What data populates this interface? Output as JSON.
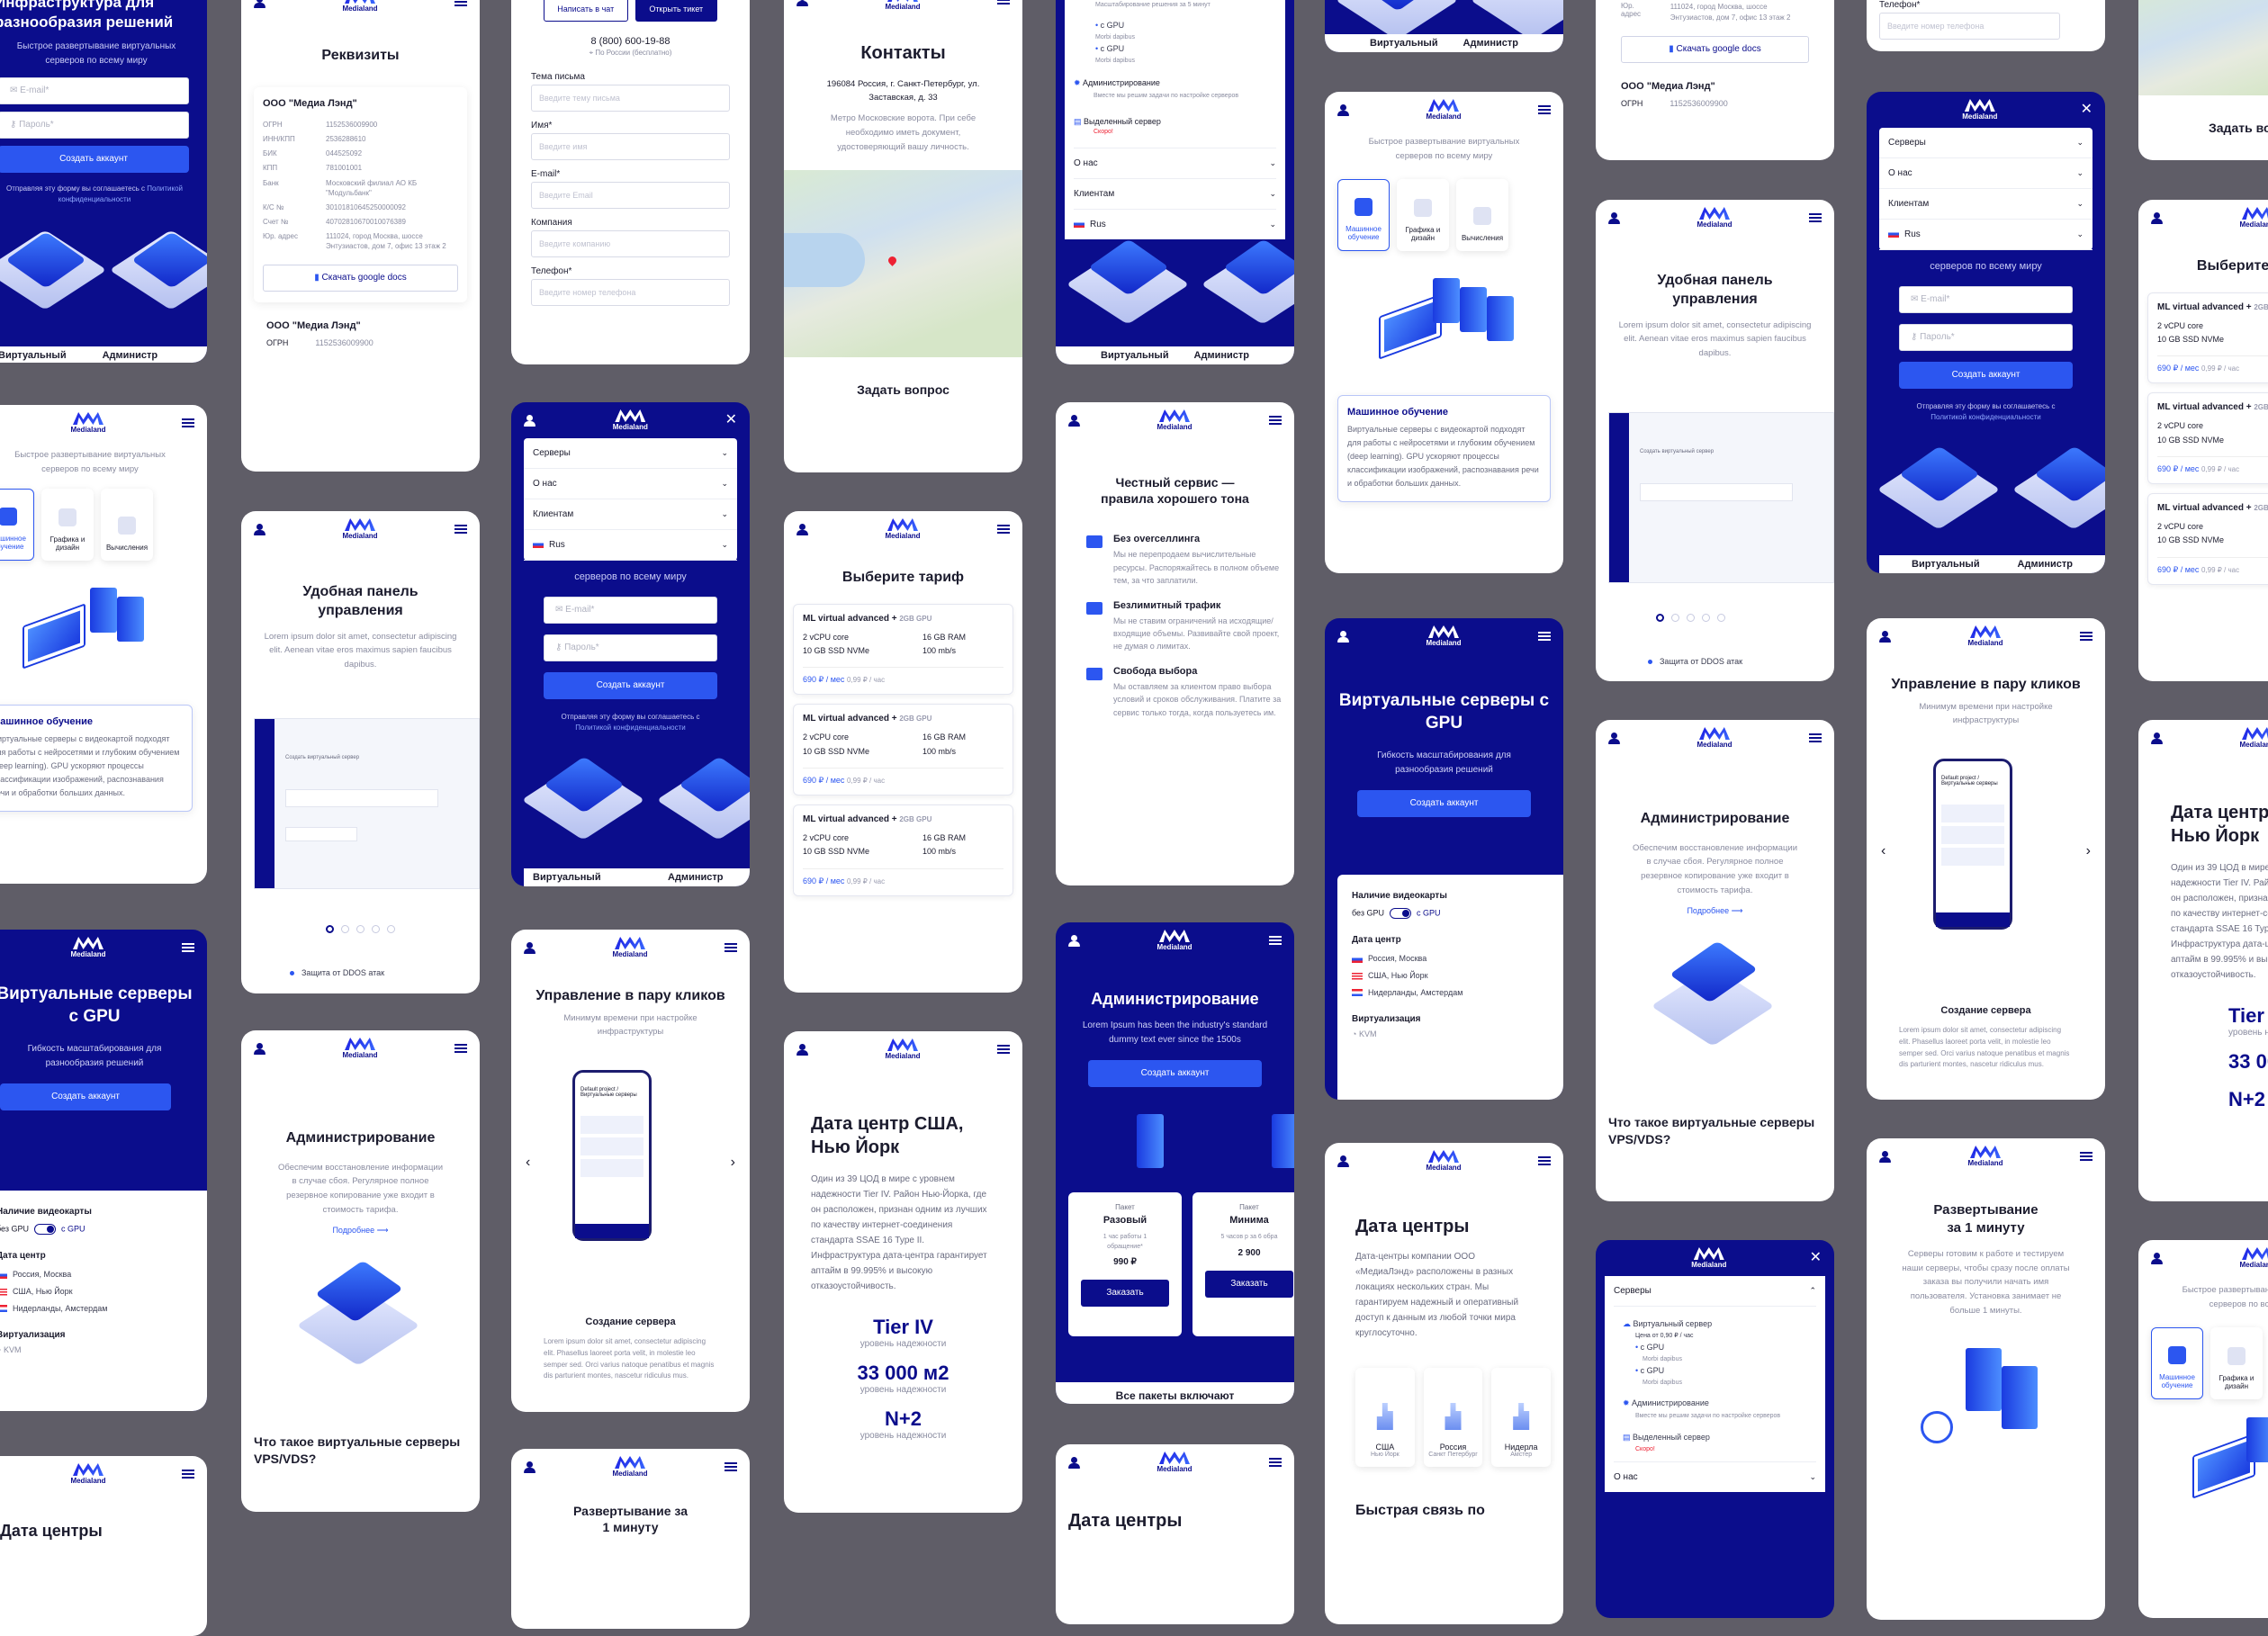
{
  "brand": {
    "logo_text": "Medialand"
  },
  "hero": {
    "title_part1": "Инфраструктура для",
    "title_part2": "разнообразия решений",
    "subtitle": "Быстрое развертывание виртуальных серверов по всему миру",
    "subtitle_tail": "серверов по всему миру",
    "email_placeholder": "E-mail*",
    "password_placeholder": "Пароль*",
    "create_account": "Создать аккаунт",
    "consent_part1": "Отправляя эту форму вы соглашаетесь с",
    "consent_link": "Политикой конфиденциальности",
    "tiles": [
      "Виртуальный",
      "Администр"
    ]
  },
  "requisites": {
    "title": "Реквизиты",
    "company": "ООО \"Медиа Лэнд\"",
    "rows": [
      {
        "k": "ОГРН",
        "v": "1152536009900"
      },
      {
        "k": "ИНН/КПП",
        "v": "2536288610"
      },
      {
        "k": "БИК",
        "v": "044525092"
      },
      {
        "k": "КПП",
        "v": "781001001"
      },
      {
        "k": "Банк",
        "v": "Московский филиал АО КБ \"Модульбанк\""
      },
      {
        "k": "К/С №",
        "v": "30101810645250000092"
      },
      {
        "k": "Счет №",
        "v": "40702810670010076389"
      },
      {
        "k": "Юр. адрес",
        "v": "111024, город Москва, шоссе Энтузиастов, дом 7, офис 13 этаж 2"
      }
    ],
    "download": "Скачать google docs"
  },
  "support": {
    "chat": "Написать в чат",
    "ticket": "Открыть тикет",
    "phone": "8 (800) 600-19-88",
    "phone_note": "По России (бесплатно)",
    "fields": [
      {
        "label": "Тема письма",
        "ph": "Введите тему письма"
      },
      {
        "label": "Имя*",
        "ph": "Введите имя"
      },
      {
        "label": "E-mail*",
        "ph": "Введите Email"
      },
      {
        "label": "Компания",
        "ph": "Введите компанию"
      },
      {
        "label": "Телефон*",
        "ph": "Введите номер телефона"
      }
    ]
  },
  "contacts": {
    "title": "Контакты",
    "address": "196084 Россия, г. Санкт-Петербург, ул. Заставская, д. 33",
    "metro": "Метро Московские ворота. При себе необходимо иметь документ, удостоверяющий вашу личность.",
    "ask": "Задать вопрос"
  },
  "menu": {
    "items": [
      "Серверы",
      "О нас",
      "Клиентам",
      "Rus"
    ],
    "sub": [
      {
        "t": "Виртуальный сервер",
        "d": "Цена от 0,90 ₽ / час"
      },
      {
        "t": "с GPU",
        "d": "Morbi dapibus"
      },
      {
        "t": "с GPU",
        "d": "Morbi dapibus"
      },
      {
        "t": "Администрирование",
        "d": "Вместе мы решим задачи по настройке серверов"
      },
      {
        "t": "Выделенный сервер",
        "d": "Скоро!"
      }
    ],
    "sub_note": "Масштабирование решения за 5 минут"
  },
  "ml": {
    "subtitle": "Быстрое развертывание виртуальных серверов по всему миру",
    "tabs": [
      "Машинное обучение",
      "Графика и дизайн",
      "Вычисления"
    ],
    "card_title": "Машинное обучение",
    "card_text": "Виртуальные серверы с видеокартой подходят для работы с нейросетями и глубоким обучением (deep learning). GPU ускоряют процессы классификации изображений, распознавания речи и обработки больших данных."
  },
  "panel": {
    "title": "Удобная панель управления",
    "text": "Lorem ipsum dolor sit amet, consectetur adipiscing elit. Aenean vitae eros maximus sapien faucibus dapibus.",
    "screen_title": "Создать виртуальный сервер",
    "ddos": "Защита от DDOS атак"
  },
  "tariff": {
    "title": "Выберите тариф",
    "plan": "ML virtual advanced +",
    "gpu": "2GB GPU",
    "cpu": "2 vCPU core",
    "ram": "16 GB RAM",
    "ssd": "10 GB SSD NVMe",
    "net": "100 mb/s",
    "price": "690 ₽ / мес",
    "hour": "0,99 ₽ / час"
  },
  "honest": {
    "title": "Честный сервис — правила хорошего тона",
    "items": [
      {
        "t": "Без overселлинга",
        "d": "Мы не перепродаем вычислительные ресурсы. Распоряжайтесь в полном объеме тем, за что заплатили."
      },
      {
        "t": "Безлимитный трафик",
        "d": "Мы не ставим ограничений на исходящие/входящие объемы. Развивайте свой проект, не думая о лимитах."
      },
      {
        "t": "Свобода выбора",
        "d": "Мы оставляем за клиентом право выбора условий и сроков обслуживания. Платите за сервис только тогда, когда пользуетесь им."
      }
    ]
  },
  "gpu": {
    "title": "Виртуальные серверы с GPU",
    "text": "Гибкость масштабирования для разнообразия решений",
    "btn": "Создать аккаунт",
    "card_label": "Наличие видеокарты",
    "no_gpu": "без GPU",
    "with_gpu": "с GPU",
    "dc_label": "Дата центр",
    "dcs": [
      "Россия, Москва",
      "США, Нью Йорк",
      "Нидерланды, Амстердам"
    ],
    "virt": "Виртуализация",
    "kvm": "KVM"
  },
  "admin": {
    "title": "Администрирование",
    "text": "Обеспечим восстановление информации в случае сбоя. Регулярное полное резервное копирование уже входит в стоимость тарифа.",
    "more": "Подробнее",
    "what": "Что такое виртуальные серверы VPS/VDS?",
    "lorem": "Lorem Ipsum has been the industry's standard dummy text ever since the 1500s",
    "pkg_type": "Пакет",
    "pkgs": [
      {
        "n": "Разовый",
        "d": "1 час работы 1 обращение*",
        "p": "990 ₽"
      },
      {
        "n": "Минима",
        "d": "5 часов р за 6 обра",
        "p": "2 900"
      }
    ],
    "order": "Заказать",
    "all": "Все пакеты включают"
  },
  "manage": {
    "title": "Управление в пару кликов",
    "text": "Минимум времени при настройке инфраструктуры",
    "phone_title": "Default project / Виртуальные серверы",
    "caption": "Создание сервера",
    "caption_text": "Lorem ipsum dolor sit amet, consectetur adipiscing elit. Phasellus laoreet porta velit, in molestie leo semper sed. Orci varius natoque penatibus et magnis dis parturient montes, nascetur ridiculus mus."
  },
  "dc": {
    "title": "Дата центр США, Нью Йорк",
    "text": "Один из 39 ЦОД в мире с уровнем надежности Tier IV. Район Нью-Йорка, где он расположен, признан одним из лучших по качеству интернет-соединения стандарта SSAE 16 Type II. Инфраструктура дата-центра гарантирует аптайм в 99.995% и высокую отказоустойчивость.",
    "stats": [
      {
        "v": "Tier IV",
        "l": "уровень надежности"
      },
      {
        "v": "33 000 м2",
        "l": "уровень надежности"
      },
      {
        "v": "N+2",
        "l": "уровень надежности"
      }
    ]
  },
  "dcs": {
    "title": "Дата центры",
    "text": "Дата-центры компании ООО «МедиаЛэнд» расположены в разных локациях нескольких стран. Мы гарантируем надежный и оперативный доступ к данным из любой точки мира круглосуточно.",
    "items": [
      {
        "n": "США",
        "c": "Нью Йорк"
      },
      {
        "n": "Россия",
        "c": "Санкт Петербург"
      },
      {
        "n": "Нидерла",
        "c": "Амстер"
      }
    ],
    "fast": "Быстрая связь по"
  },
  "deploy": {
    "title": "Развертывание за 1 минуту",
    "text": "Серверы готовим к работе и тестируем наши серверы, чтобы сразу после оплаты заказа вы получили начать имя пользователя. Установка занимает не больше 1 минуты."
  },
  "tier": {
    "t": "Tier",
    "l": "уровень на",
    "v": "33 00",
    "n": "N+2"
  }
}
